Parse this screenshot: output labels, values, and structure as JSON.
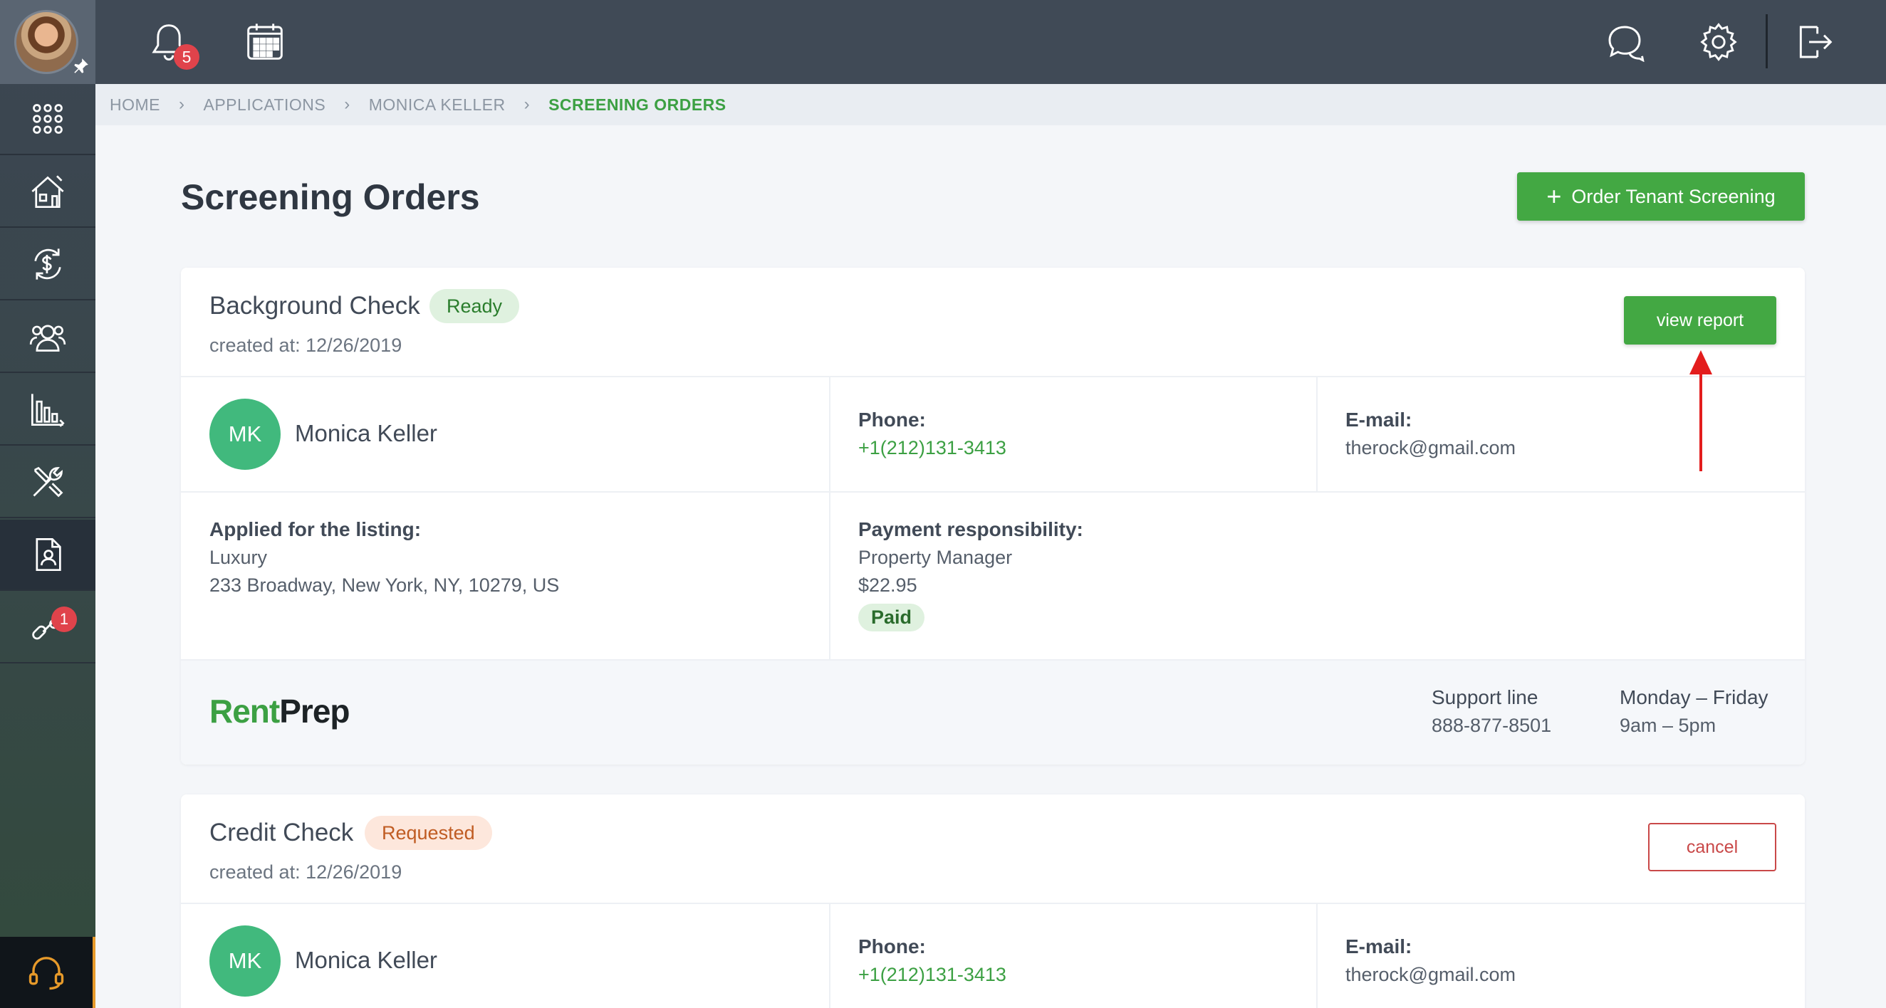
{
  "topbar": {
    "notifications_count": "5"
  },
  "sidebar": {
    "items": [
      {
        "name": "apps"
      },
      {
        "name": "properties"
      },
      {
        "name": "accounting"
      },
      {
        "name": "people"
      },
      {
        "name": "reports"
      },
      {
        "name": "maintenance"
      },
      {
        "name": "applications"
      },
      {
        "name": "integrations",
        "badge": "1"
      }
    ]
  },
  "breadcrumb": {
    "items": [
      "HOME",
      "APPLICATIONS",
      "MONICA KELLER",
      "SCREENING ORDERS"
    ]
  },
  "page": {
    "title": "Screening Orders",
    "order_button": "Order Tenant Screening"
  },
  "orders": [
    {
      "title": "Background Check",
      "status": "Ready",
      "created": "created at: 12/26/2019",
      "action": "view report",
      "initials": "MK",
      "name": "Monica Keller",
      "phone_label": "Phone:",
      "phone": "+1(212)131-3413",
      "email_label": "E-mail:",
      "email": "therock@gmail.com",
      "listing_label": "Applied for the listing:",
      "listing_name": "Luxury",
      "listing_address": "233 Broadway, New York, NY, 10279, US",
      "payment_label": "Payment responsibility:",
      "payment_party": "Property Manager",
      "payment_amount": "$22.95",
      "payment_status": "Paid",
      "support_label": "Support line",
      "support_phone": "888-877-8501",
      "hours_label": "Monday – Friday",
      "hours": "9am – 5pm",
      "logo_left": "Rent",
      "logo_right": "Prep"
    },
    {
      "title": "Credit Check",
      "status": "Requested",
      "created": "created at: 12/26/2019",
      "action": "cancel",
      "initials": "MK",
      "name": "Monica Keller",
      "phone_label": "Phone:",
      "phone": "+1(212)131-3413",
      "email_label": "E-mail:",
      "email": "therock@gmail.com"
    }
  ],
  "colors": {
    "accent": "#43a843",
    "sidebar": "#3c4652",
    "topbar": "#404a56",
    "danger": "#c94848"
  }
}
